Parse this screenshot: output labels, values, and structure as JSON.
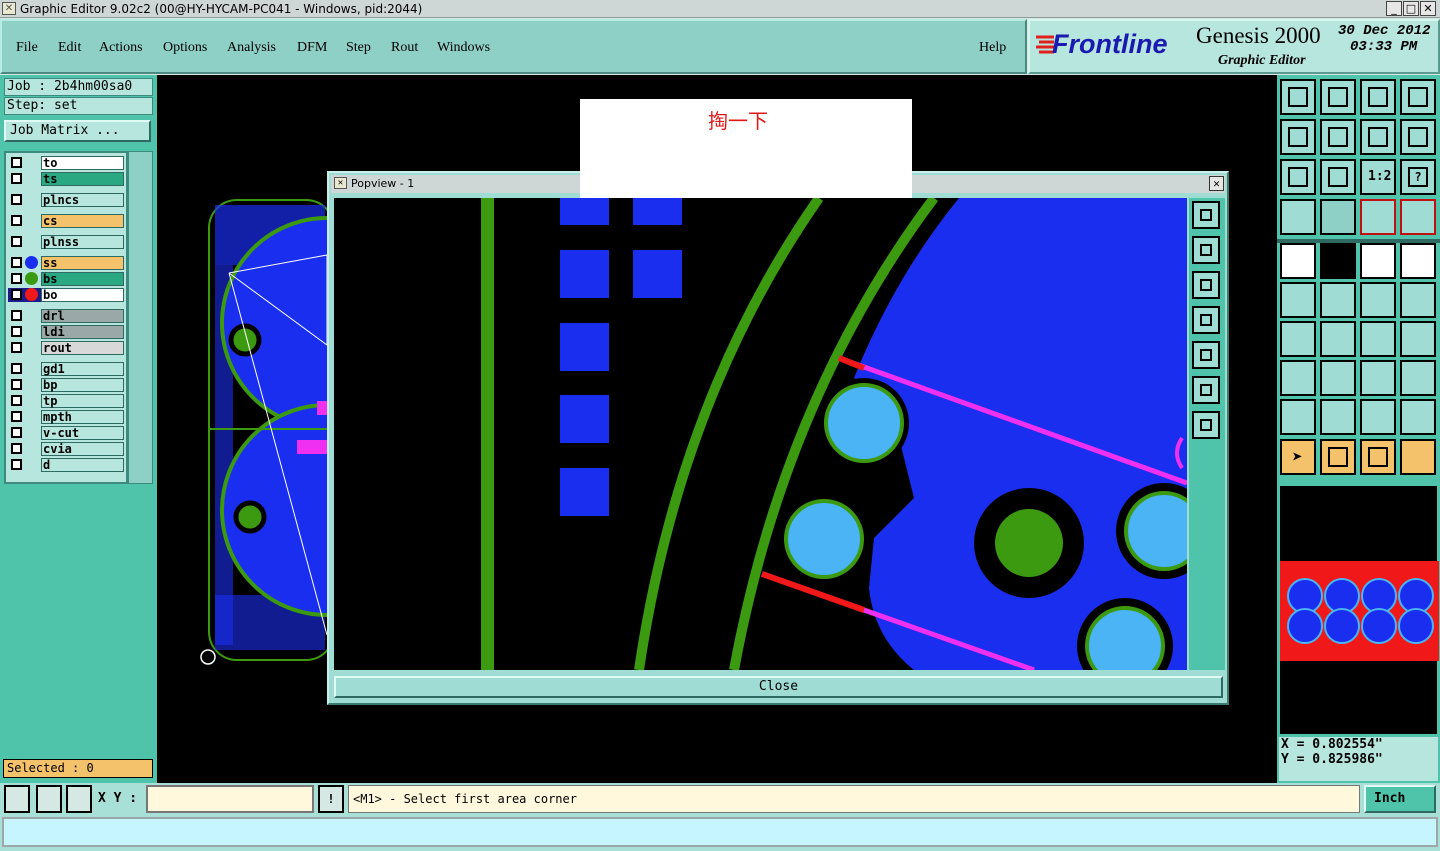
{
  "window": {
    "title": "Graphic Editor 9.02c2 (00@HY-HYCAM-PC041 - Windows, pid:2044)"
  },
  "menu": {
    "items": [
      "File",
      "Edit",
      "Actions",
      "Options",
      "Analysis",
      "DFM",
      "Step",
      "Rout",
      "Windows"
    ],
    "help": "Help"
  },
  "brand": {
    "logo": "Frontline",
    "product": "Genesis 2000",
    "subtitle": "Graphic Editor",
    "date": "30 Dec 2012",
    "time": "03:33 PM"
  },
  "job": {
    "job_label": "Job : 2b4hm00sa0",
    "step_label": "Step: set",
    "matrix_button": "Job Matrix ..."
  },
  "layers": [
    {
      "name": "to",
      "color": "#ffffff"
    },
    {
      "name": "ts",
      "color": "#2aa882"
    },
    {
      "name": "plncs",
      "color": "#b6e6de"
    },
    {
      "name": "cs",
      "color": "#f4c26a"
    },
    {
      "name": "plnss",
      "color": "#b6e6de"
    },
    {
      "name": "ss",
      "color": "#f4c26a"
    },
    {
      "name": "bs",
      "color": "#2aa882"
    },
    {
      "name": "bo",
      "color": "#ffffff"
    },
    {
      "name": "drl",
      "color": "#9aa8a8"
    },
    {
      "name": "ldi",
      "color": "#9aa8a8"
    },
    {
      "name": "rout",
      "color": "#d8d8d8"
    },
    {
      "name": "gd1",
      "color": "#b6e6de"
    },
    {
      "name": "bp",
      "color": "#b6e6de"
    },
    {
      "name": "tp",
      "color": "#b6e6de"
    },
    {
      "name": "mpth",
      "color": "#b6e6de"
    },
    {
      "name": "v-cut",
      "color": "#b6e6de"
    },
    {
      "name": "cvia",
      "color": "#b6e6de"
    },
    {
      "name": "d",
      "color": "#b6e6de"
    }
  ],
  "status": {
    "selected": "Selected : 0"
  },
  "note": {
    "text": "掏一下"
  },
  "popview": {
    "title": "Popview - 1",
    "close_label": "Close"
  },
  "coords": {
    "x": "X = 0.802554\"",
    "y": "Y = 0.825986\""
  },
  "command": {
    "xy_label": "X Y :",
    "xy_value": "",
    "prompt": "<M1> - Select first area corner",
    "units": "Inch"
  },
  "colors": {
    "panel": "#4fc4aa",
    "menubar": "#8fd0c6",
    "copper": "#1a2ef0",
    "pad": "#4ab4f4",
    "green": "#3c9a10",
    "magenta": "#f030f0",
    "red": "#f01818"
  }
}
